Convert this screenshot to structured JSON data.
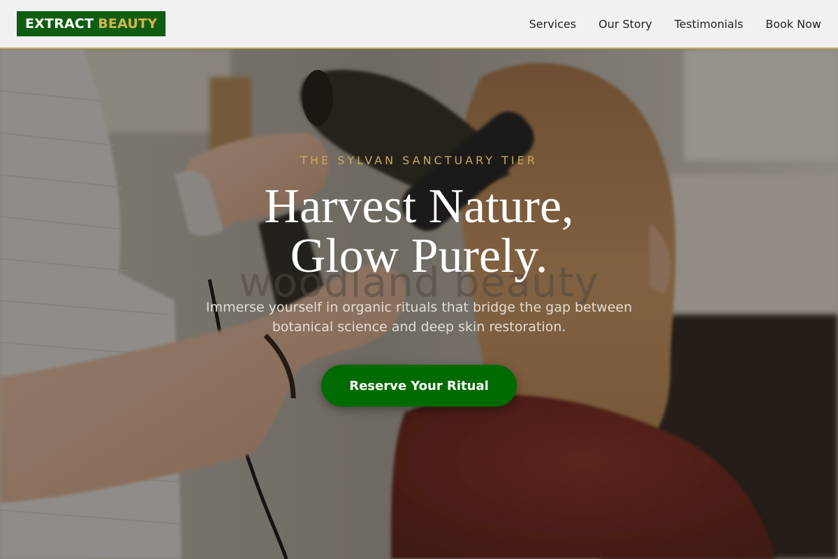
{
  "brand": {
    "word1": "EXTRACT",
    "word2": "BEAUTY",
    "accent_color": "#d4b64e",
    "bg_color": "#0f5d12"
  },
  "nav": {
    "items": [
      {
        "label": "Services"
      },
      {
        "label": "Our Story"
      },
      {
        "label": "Testimonials"
      },
      {
        "label": "Book Now"
      }
    ]
  },
  "hero": {
    "eyebrow": "THE SYLVAN SANCTUARY TIER",
    "headline_line1": "Harvest Nature,",
    "headline_line2": "Glow Purely.",
    "watermark": "woodland beauty",
    "subtitle": "Immerse yourself in organic rituals that bridge the gap between botanical science and deep skin restoration.",
    "cta_label": "Reserve Your Ritual",
    "cta_color": "#006b00",
    "background_image": "salon stylist blow-drying client hair"
  }
}
